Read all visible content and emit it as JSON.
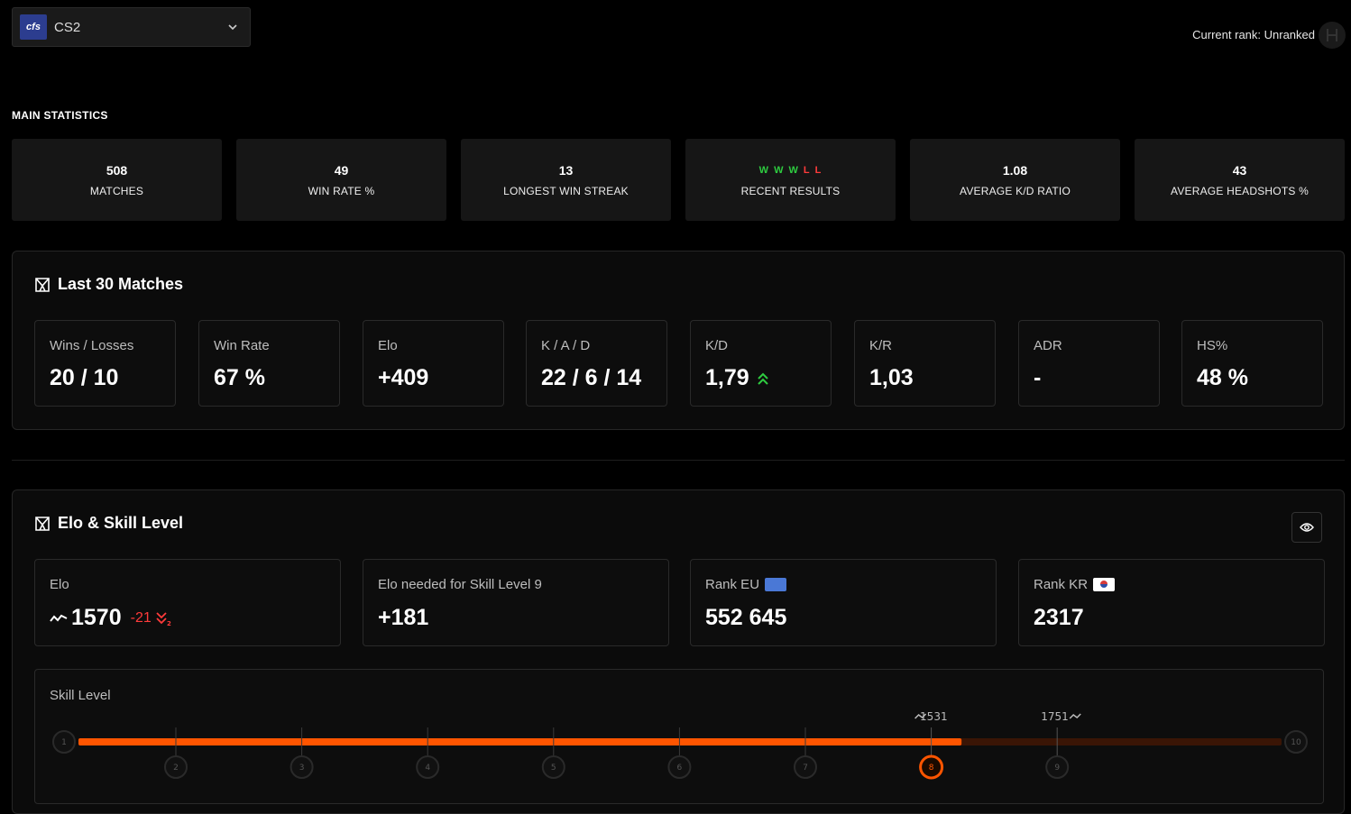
{
  "game_selector": {
    "logo_text": "cfs",
    "name": "CS2"
  },
  "current_rank": "Current rank: Unranked",
  "main_statistics": {
    "title": "MAIN STATISTICS",
    "cards": [
      {
        "value": "508",
        "label": "MATCHES"
      },
      {
        "value": "49",
        "label": "WIN RATE %"
      },
      {
        "value": "13",
        "label": "LONGEST WIN STREAK"
      },
      {
        "value": null,
        "label": "RECENT RESULTS",
        "results": [
          "W",
          "W",
          "W",
          "L",
          "L"
        ]
      },
      {
        "value": "1.08",
        "label": "AVERAGE K/D RATIO"
      },
      {
        "value": "43",
        "label": "AVERAGE HEADSHOTS %"
      }
    ]
  },
  "last30": {
    "title": "Last 30 Matches",
    "cards": [
      {
        "label": "Wins / Losses",
        "value": "20 / 10"
      },
      {
        "label": "Win Rate",
        "value": "67 %"
      },
      {
        "label": "Elo",
        "value": "+409"
      },
      {
        "label": "K / A / D",
        "value": "22 / 6 / 14"
      },
      {
        "label": "K/D",
        "value": "1,79"
      },
      {
        "label": "K/R",
        "value": "1,03"
      },
      {
        "label": "ADR",
        "value": "-"
      },
      {
        "label": "HS%",
        "value": "48 %"
      }
    ]
  },
  "elo_skill": {
    "title": "Elo & Skill Level",
    "elo_label": "Elo",
    "elo_value": "1570",
    "elo_delta": "-21",
    "needed_label": "Elo needed for Skill Level 9",
    "needed_value": "+181",
    "rank_eu_label": "Rank EU",
    "rank_eu_value": "552 645",
    "rank_kr_label": "Rank KR",
    "rank_kr_value": "2317",
    "skill_label": "Skill Level",
    "skill_progress": {
      "current_level": 8,
      "fill_fraction": 0.734,
      "marker_left": "1531",
      "marker_right": "1751"
    },
    "levels": [
      "1",
      "2",
      "3",
      "4",
      "5",
      "6",
      "7",
      "8",
      "9",
      "10"
    ]
  },
  "colors": {
    "accent": "#ff5500",
    "win": "#2ecc40",
    "loss": "#ff3b3b"
  }
}
